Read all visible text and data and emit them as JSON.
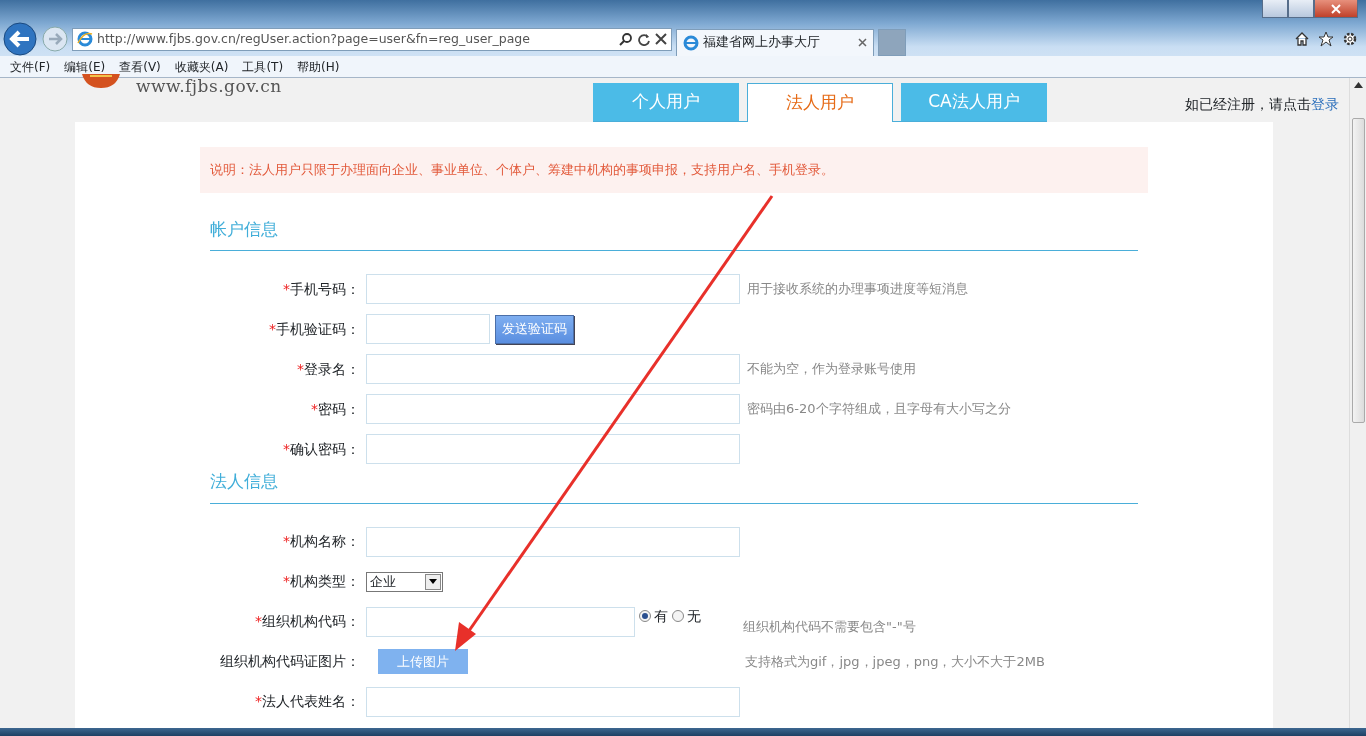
{
  "browser": {
    "address": "http://www.fjbs.gov.cn/regUser.action?page=user&fn=reg_user_page",
    "tab_title": "福建省网上办事大厅",
    "menu": [
      "文件(F)",
      "编辑(E)",
      "查看(V)",
      "收藏夹(A)",
      "工具(T)",
      "帮助(H)"
    ]
  },
  "site": {
    "logo_text": "www.fjbs.gov.cn"
  },
  "user_tabs": [
    {
      "label": "个人用户",
      "selected": false
    },
    {
      "label": "法人用户",
      "selected": true
    },
    {
      "label": "CA法人用户",
      "selected": false
    }
  ],
  "login_prompt": {
    "text": "如已经注册，请点击",
    "link": "登录"
  },
  "notice": "说明：法人用户只限于办理面向企业、事业单位、个体户、筹建中机构的事项申报，支持用户名、手机登录。",
  "sections": [
    {
      "title": "帐户信息",
      "fields": [
        {
          "kind": "text",
          "required_mark": "*",
          "label": "手机号码：",
          "hint": "用于接收系统的办理事项进度等短消息"
        },
        {
          "kind": "text_button",
          "required_mark": "*",
          "label": "手机验证码：",
          "button": "发送验证码"
        },
        {
          "kind": "text",
          "required_mark": "*",
          "label": "登录名：",
          "hint": "不能为空，作为登录账号使用"
        },
        {
          "kind": "text",
          "required_mark": "*",
          "label": "密码：",
          "hint": "密码由6-20个字符组成，且字母有大小写之分"
        },
        {
          "kind": "text",
          "required_mark": "*",
          "label": "确认密码："
        }
      ]
    },
    {
      "title": "法人信息",
      "fields": [
        {
          "kind": "text",
          "required_mark": "*",
          "label": "机构名称："
        },
        {
          "kind": "select",
          "required_mark": "*",
          "label": "机构类型：",
          "value": "企业"
        },
        {
          "kind": "radio",
          "required_mark": "*",
          "label": "组织机构代码：",
          "options": [
            {
              "label": "有",
              "selected": true
            },
            {
              "label": "无",
              "selected": false
            }
          ],
          "hint": "组织机构代码不需要包含\"-\"号"
        },
        {
          "kind": "upload",
          "label": "组织机构代码证图片：",
          "button": "上传图片",
          "hint": "支持格式为gif，jpg，jpeg，png，大小不大于2MB"
        },
        {
          "kind": "text",
          "required_mark": "*",
          "label": "法人代表姓名："
        }
      ]
    }
  ]
}
